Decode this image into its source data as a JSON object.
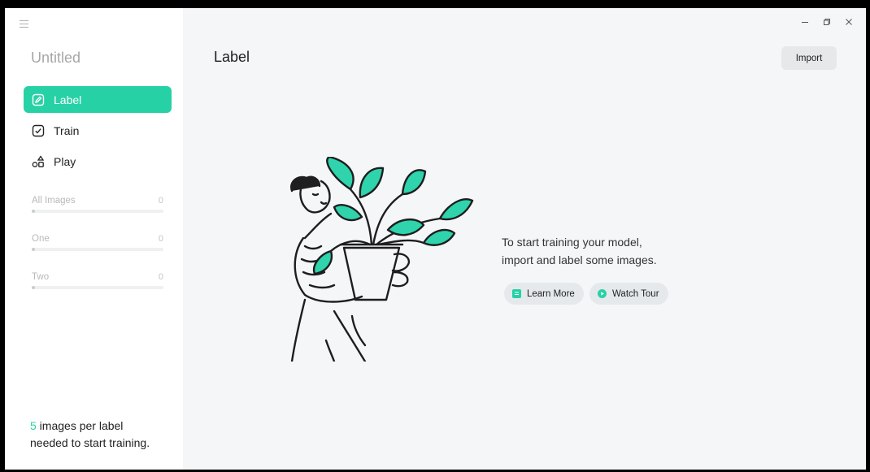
{
  "sidebar": {
    "project_title": "Untitled",
    "nav": [
      {
        "label": "Label",
        "icon": "edit-icon",
        "active": true
      },
      {
        "label": "Train",
        "icon": "check-square-icon",
        "active": false
      },
      {
        "label": "Play",
        "icon": "shapes-icon",
        "active": false
      }
    ],
    "labels": [
      {
        "name": "All Images",
        "count": "0",
        "progress": 0
      },
      {
        "name": "One",
        "count": "0",
        "progress": 0
      },
      {
        "name": "Two",
        "count": "0",
        "progress": 0
      }
    ],
    "footnote": {
      "count": "5",
      "text_line1": " images per label",
      "text_line2": "needed to start training."
    }
  },
  "main": {
    "title": "Label",
    "import_label": "Import",
    "empty_message_line1": "To start training your model,",
    "empty_message_line2": "import and label some images.",
    "learn_more_label": "Learn More",
    "watch_tour_label": "Watch Tour"
  },
  "colors": {
    "accent": "#27d1a6",
    "background": "#f4f6f8",
    "sidebar": "#ffffff"
  }
}
